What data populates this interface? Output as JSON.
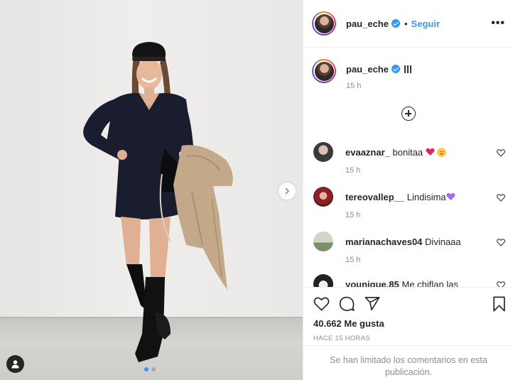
{
  "post": {
    "author": "pau_eche",
    "follow_label": "Seguir",
    "bullet": "•",
    "more_label": "•••"
  },
  "caption": {
    "username": "pau_eche",
    "time": "15 h"
  },
  "comments": [
    {
      "username": "evaaznar_",
      "text": "bonitaa",
      "time": "15 h",
      "emojis": [
        "red-heart",
        "heart-eyes-face"
      ]
    },
    {
      "username": "tereovallep__",
      "text": "Lindisima",
      "time": "15 h",
      "emojis": [
        "purple-heart"
      ]
    },
    {
      "username": "marianachaves04",
      "text": "Divinaaa",
      "time": "15 h",
      "emojis": []
    },
    {
      "username": "younique.85",
      "text": "Me chiflan las",
      "time": "",
      "emojis": []
    }
  ],
  "actions": {
    "likes": "40.662 Me gusta",
    "posted": "HACE 15 HORAS",
    "comments_limited": "Se han limitado los comentarios en esta publicación."
  },
  "carousel": {
    "slides": 2,
    "active": 0
  },
  "colors": {
    "accent": "#3897f0",
    "text": "#262626",
    "muted": "#8e8e8e",
    "border": "#efefef"
  }
}
